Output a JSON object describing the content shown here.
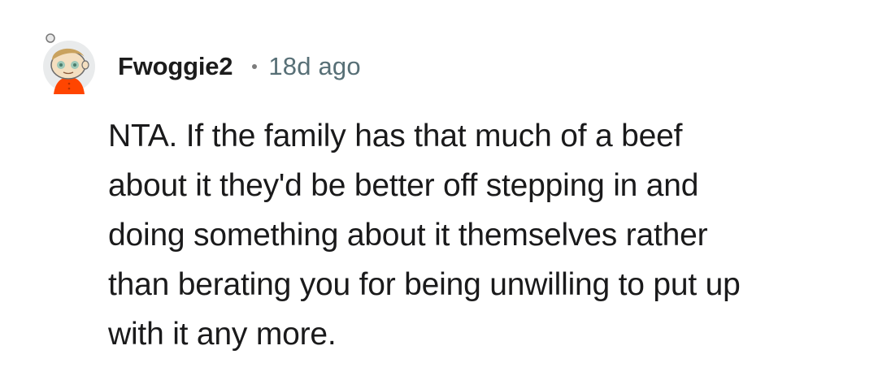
{
  "comment": {
    "author": "Fwoggie2",
    "age": "18d ago",
    "avatar_icon": "snoo-avatar-icon",
    "body_lines": [
      "NTA. If the family has that much of a beef",
      "about it they'd be better off stepping in and",
      "doing something about it themselves rather",
      "than berating you for being unwilling to put up",
      "with it any more."
    ]
  },
  "colors": {
    "avatar_background": "#e9ebec",
    "avatar_shirt": "#ff4500",
    "avatar_skin": "#f5deb3",
    "avatar_hair": "#c9a25e",
    "timestamp": "#576f76",
    "text": "#1a1a1b"
  }
}
